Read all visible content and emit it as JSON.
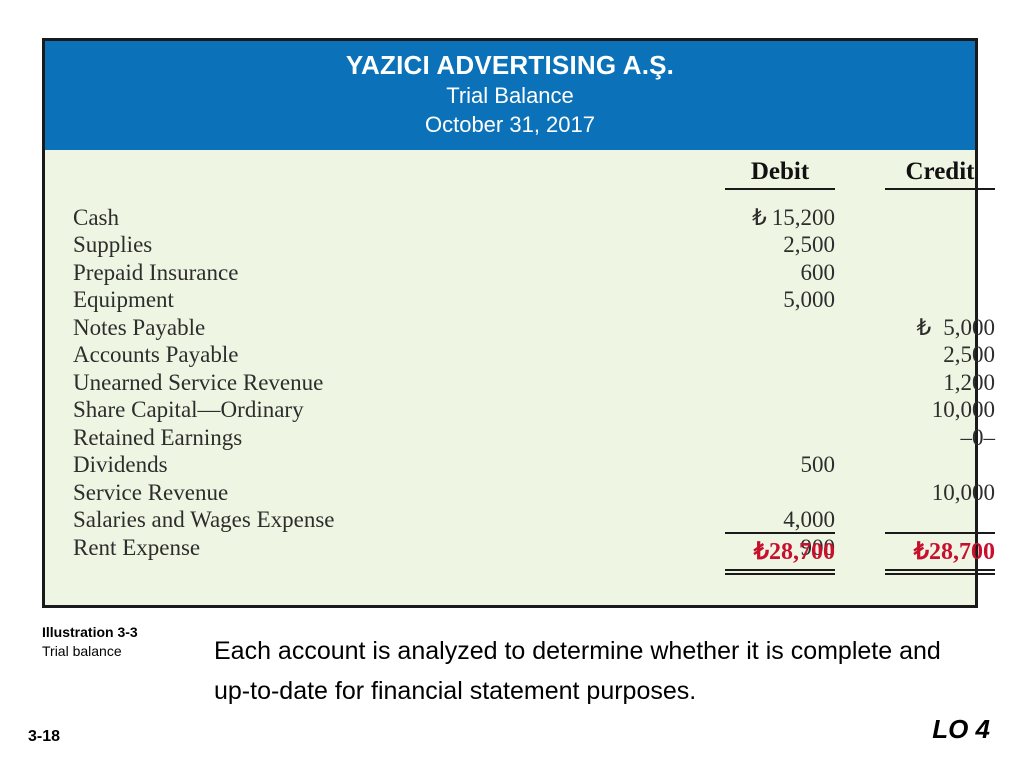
{
  "slide": {
    "number": "3-18",
    "lo_tag": "LO 4"
  },
  "illustration": {
    "title": "Illustration 3-3",
    "subtitle": "Trial balance"
  },
  "body_text": "Each account is analyzed to determine whether it is complete and up-to-date for financial statement purposes.",
  "trial_balance": {
    "company": "YAZICI ADVERTISING A.Ş.",
    "statement": "Trial Balance",
    "date": "October 31, 2017",
    "currency_symbol": "₺",
    "columns": {
      "debit": "Debit",
      "credit": "Credit"
    },
    "colors": {
      "header_blue": "#0b72b9",
      "body_green": "#eef5e2",
      "border": "#1a1a1a",
      "total_red": "#c8102e"
    },
    "rows": [
      {
        "account": "Cash",
        "debit": "15,200",
        "credit": "",
        "debit_symbol": true,
        "credit_symbol": false
      },
      {
        "account": "Supplies",
        "debit": "2,500",
        "credit": "",
        "debit_symbol": false,
        "credit_symbol": false
      },
      {
        "account": "Prepaid Insurance",
        "debit": "600",
        "credit": "",
        "debit_symbol": false,
        "credit_symbol": false
      },
      {
        "account": "Equipment",
        "debit": "5,000",
        "credit": "",
        "debit_symbol": false,
        "credit_symbol": false
      },
      {
        "account": "Notes Payable",
        "debit": "",
        "credit": "5,000",
        "debit_symbol": false,
        "credit_symbol": true
      },
      {
        "account": "Accounts Payable",
        "debit": "",
        "credit": "2,500",
        "debit_symbol": false,
        "credit_symbol": false
      },
      {
        "account": "Unearned Service Revenue",
        "debit": "",
        "credit": "1,200",
        "debit_symbol": false,
        "credit_symbol": false
      },
      {
        "account": "Share Capital—Ordinary",
        "debit": "",
        "credit": "10,000",
        "debit_symbol": false,
        "credit_symbol": false
      },
      {
        "account": "Retained Earnings",
        "debit": "",
        "credit": "–0–",
        "debit_symbol": false,
        "credit_symbol": false
      },
      {
        "account": "Dividends",
        "debit": "500",
        "credit": "",
        "debit_symbol": false,
        "credit_symbol": false
      },
      {
        "account": "Service Revenue",
        "debit": "",
        "credit": "10,000",
        "debit_symbol": false,
        "credit_symbol": false
      },
      {
        "account": "Salaries and Wages Expense",
        "debit": "4,000",
        "credit": "",
        "debit_symbol": false,
        "credit_symbol": false
      },
      {
        "account": "Rent Expense",
        "debit": "900",
        "credit": "",
        "debit_symbol": false,
        "credit_symbol": false
      }
    ],
    "totals": {
      "debit": "₺28,700",
      "credit": "₺28,700"
    }
  }
}
